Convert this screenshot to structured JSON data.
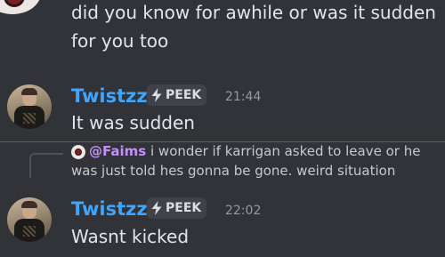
{
  "top_context": {
    "line1": "did you know for awhile or was it sudden",
    "line2": "for you too"
  },
  "messages": [
    {
      "author": "Twistzz",
      "badge": "PEEK",
      "time": "21:44",
      "text": "It was sudden"
    },
    {
      "reply": {
        "mention": "@Faims",
        "line1": "i wonder if karrigan asked to leave or he",
        "line2": "was just told hes gonna be gone. weird situation"
      },
      "author": "Twistzz",
      "badge": "PEEK",
      "time": "22:02",
      "text": "Wasnt kicked"
    }
  ],
  "colors": {
    "background": "#313338",
    "username": "#3ea6ff",
    "mention": "#c38fff",
    "divider": "#4e5aa8",
    "badge_bg": "#404249"
  },
  "icons": {
    "badge_icon": "lightning-bolt-icon"
  }
}
